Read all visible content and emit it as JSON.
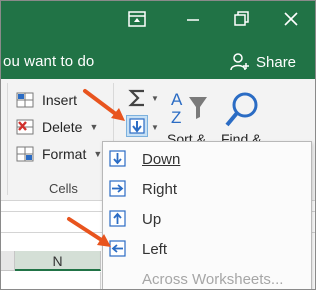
{
  "titlebar": {
    "tell_me": "ou want to do",
    "share_label": "Share",
    "bg_color": "#217346"
  },
  "ribbon": {
    "cells_group": {
      "insert_label": "Insert",
      "delete_label": "Delete",
      "format_label": "Format",
      "group_label": "Cells"
    },
    "editing_group": {
      "sort_label": "Sort &",
      "find_label": "Find &"
    }
  },
  "sheet": {
    "column_label": "N"
  },
  "fill_menu": {
    "items": [
      {
        "label": "Down",
        "icon": "fill-down-icon",
        "enabled": true
      },
      {
        "label": "Right",
        "icon": "fill-right-icon",
        "enabled": true
      },
      {
        "label": "Up",
        "icon": "fill-up-icon",
        "enabled": true
      },
      {
        "label": "Left",
        "icon": "fill-left-icon",
        "enabled": true
      },
      {
        "label": "Across Worksheets...",
        "icon": "",
        "enabled": false
      }
    ]
  },
  "colors": {
    "accent": "#217346",
    "icon_blue": "#2b6cc4",
    "annotation_arrow": "#e8541e"
  }
}
